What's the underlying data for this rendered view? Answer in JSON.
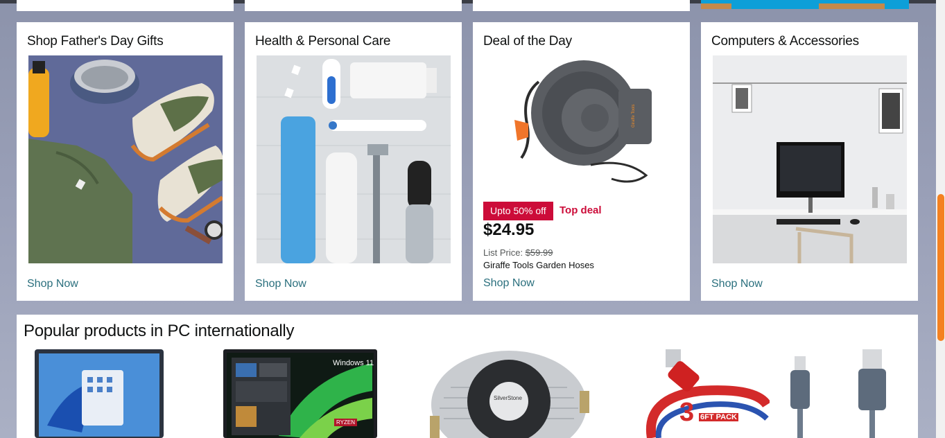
{
  "cards": [
    {
      "title": "Shop Father's Day Gifts",
      "link": "Shop Now"
    },
    {
      "title": "Health & Personal Care",
      "link": "Shop Now"
    },
    {
      "title": "Deal of the Day",
      "link": "Shop Now",
      "deal": {
        "badge": "Upto 50% off",
        "tag": "Top deal",
        "price": "$24.95",
        "list_label": "List Price:",
        "list_price": "$59.99",
        "product": "Giraffe Tools Garden Hoses",
        "brand_text": "Giraffe Tools"
      }
    },
    {
      "title": "Computers & Accessories",
      "link": "Shop Now"
    }
  ],
  "popular": {
    "title": "Popular products in PC internationally",
    "items": [
      {
        "icon": "laptop-windows-icon"
      },
      {
        "icon": "laptop-windows11-icon",
        "badge": "Windows 11",
        "badge2": "RYZEN"
      },
      {
        "icon": "cpu-cooler-icon",
        "brand": "SilverStone"
      },
      {
        "icon": "red-cable-icon",
        "pack": "3",
        "pack_label": "6FT PACK"
      },
      {
        "icon": "lightning-cable-icon"
      }
    ]
  },
  "colors": {
    "accent_link": "#2a6f7d",
    "deal_red": "#cc0c39",
    "scroll": "#f48120"
  }
}
